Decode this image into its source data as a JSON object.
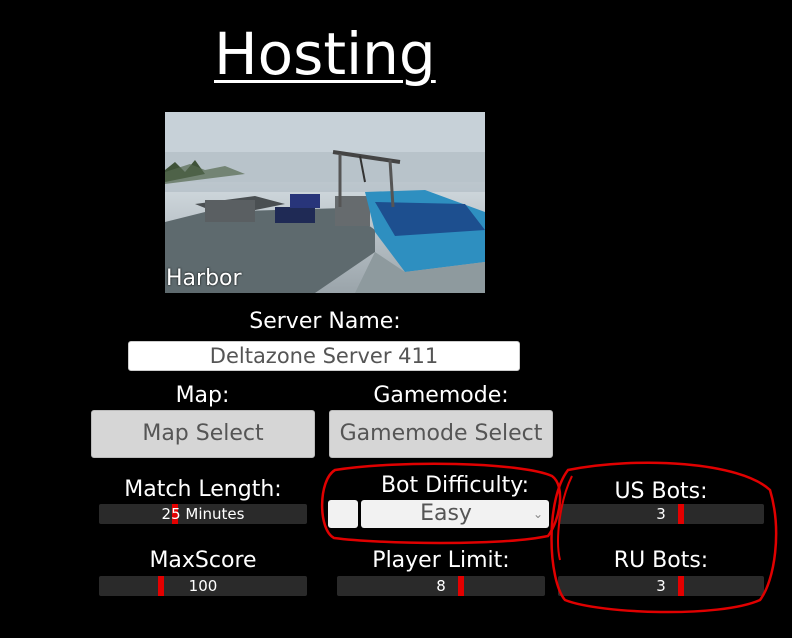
{
  "page": {
    "title": "Hosting"
  },
  "map_preview": {
    "caption": "Harbor"
  },
  "server_name": {
    "label": "Server Name:",
    "value": "Deltazone Server 411"
  },
  "map": {
    "label": "Map:",
    "button_label": "Map Select"
  },
  "gamemode": {
    "label": "Gamemode:",
    "button_label": "Gamemode Select"
  },
  "match_length": {
    "label": "Match Length:",
    "value_text": "25 Minutes",
    "level": 0.36
  },
  "bot_difficulty": {
    "label": "Bot Difficulty:",
    "selected": "Easy",
    "chevron_icon": "chevron-down-icon"
  },
  "us_bots": {
    "label": "US Bots:",
    "value_text": "3",
    "level": 0.6
  },
  "max_score": {
    "label": "MaxScore",
    "value_text": "100",
    "level": 0.29
  },
  "player_limit": {
    "label": "Player Limit:",
    "value_text": "8",
    "level": 0.6
  },
  "ru_bots": {
    "label": "RU Bots:",
    "value_text": "3",
    "level": 0.6
  },
  "colors": {
    "background": "#000000",
    "slider_track": "#2a2a2a",
    "slider_handle": "#e30000",
    "annotation": "#e00000"
  }
}
